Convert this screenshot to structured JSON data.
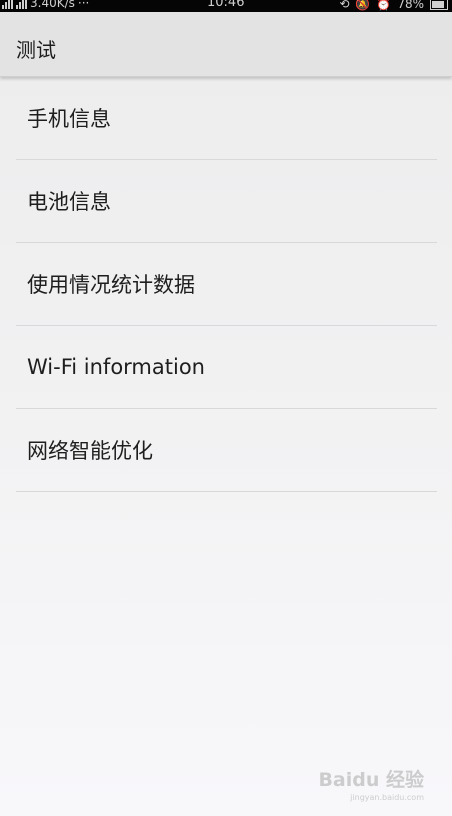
{
  "status_bar": {
    "speed": "3.40K/s",
    "dots": "···",
    "time": "10:46",
    "battery": "78%"
  },
  "app_bar": {
    "title": "测试"
  },
  "menu": {
    "items": [
      {
        "label": "手机信息"
      },
      {
        "label": "电池信息"
      },
      {
        "label": "使用情况统计数据"
      },
      {
        "label": "Wi-Fi information"
      },
      {
        "label": "网络智能优化"
      }
    ]
  },
  "watermark": {
    "logo": "Baidu 经验",
    "url": "jingyan.baidu.com"
  }
}
